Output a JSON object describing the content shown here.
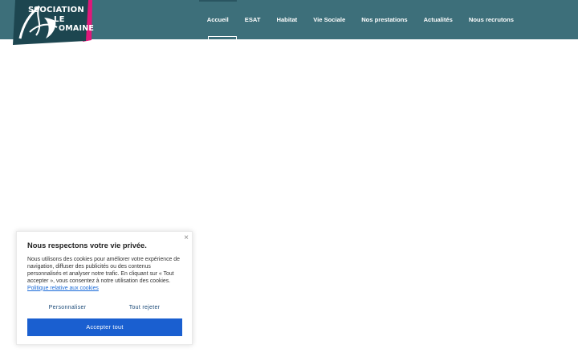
{
  "header": {
    "background": "#3d6f7a",
    "logo": {
      "line1": "SSOCIATION",
      "line2": "LE",
      "line3": "OMAINE",
      "colors": {
        "dark": "#1d4650",
        "accent": "#e0187a"
      }
    },
    "nav": [
      {
        "label": "Accueil",
        "active": true
      },
      {
        "label": "ESAT"
      },
      {
        "label": "Habitat"
      },
      {
        "label": "Vie Sociale"
      },
      {
        "label": "Nos prestations"
      },
      {
        "label": "Actualités"
      },
      {
        "label": "Nous recrutons"
      }
    ]
  },
  "cookie": {
    "close_icon": "close-icon",
    "title": "Nous respectons votre vie privée.",
    "body": "Nous utilisons des cookies pour améliorer votre expérience de navigation, diffuser des publicités ou des contenus personnalisés et analyser notre trafic. En cliquant sur « Tout accepter », vous consentez à notre utilisation des cookies.",
    "link": "Politique relative aux cookies",
    "customize": "Personnaliser",
    "reject": "Tout rejeter",
    "accept": "Accepter tout",
    "accent": "#1a5fd0"
  }
}
